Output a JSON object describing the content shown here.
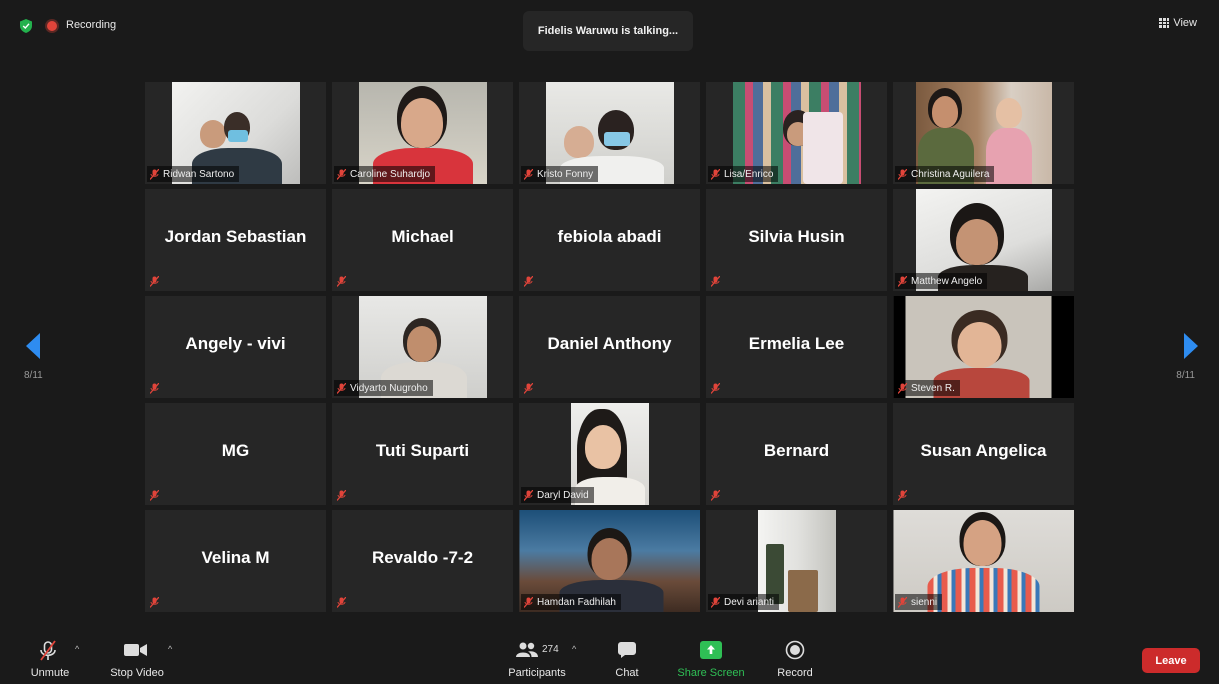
{
  "topbar": {
    "recording_label": "Recording",
    "talking_text": "Fidelis Waruwu is talking...",
    "view_label": "View"
  },
  "gallery": {
    "page_left": "8/11",
    "page_right": "8/11",
    "tiles": [
      {
        "name": "Ridwan Sartono",
        "video": true
      },
      {
        "name": "Caroline Suhardjo",
        "video": true
      },
      {
        "name": "Kristo Fonny",
        "video": true
      },
      {
        "name": "Lisa/Enrico",
        "video": true
      },
      {
        "name": "Christina Aguilera",
        "video": true
      },
      {
        "name": "Jordan Sebastian",
        "video": false
      },
      {
        "name": "Michael",
        "video": false
      },
      {
        "name": "febiola abadi",
        "video": false
      },
      {
        "name": "Silvia Husin",
        "video": false
      },
      {
        "name": "Matthew Angelo",
        "video": true
      },
      {
        "name": "Angely - vivi",
        "video": false
      },
      {
        "name": "Vidyarto Nugroho",
        "video": true
      },
      {
        "name": "Daniel Anthony",
        "video": false
      },
      {
        "name": "Ermelia Lee",
        "video": false
      },
      {
        "name": "Steven R.",
        "video": true
      },
      {
        "name": "MG",
        "video": false
      },
      {
        "name": "Tuti Suparti",
        "video": false
      },
      {
        "name": "Daryl David",
        "video": true
      },
      {
        "name": "Bernard",
        "video": false
      },
      {
        "name": "Susan Angelica",
        "video": false
      },
      {
        "name": "Velina M",
        "video": false
      },
      {
        "name": "Revaldo -7-2",
        "video": false
      },
      {
        "name": "Hamdan Fadhilah",
        "video": true
      },
      {
        "name": "Devi arianti",
        "video": true
      },
      {
        "name": "sienni",
        "video": true
      }
    ]
  },
  "toolbar": {
    "unmute": "Unmute",
    "stop_video": "Stop Video",
    "participants_count": "274",
    "participants": "Participants",
    "chat": "Chat",
    "share_screen": "Share Screen",
    "record": "Record",
    "leave": "Leave"
  },
  "colors": {
    "accent_blue": "#2e8cf0",
    "share_green": "#2fbf55",
    "leave_red": "#cc2b2b",
    "muted_red": "#e0443a"
  }
}
